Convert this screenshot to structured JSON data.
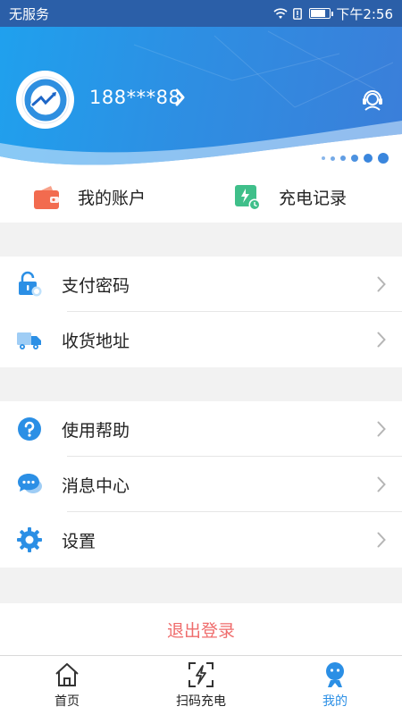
{
  "status_bar": {
    "carrier": "无服务",
    "time": "下午2:56",
    "battery_level": 0.8
  },
  "profile": {
    "phone": "188***88"
  },
  "quick_actions": [
    {
      "label": "我的账户",
      "icon": "wallet-icon",
      "color": "#f26b4f"
    },
    {
      "label": "充电记录",
      "icon": "charge-record-icon",
      "color": "#3fbf8a"
    }
  ],
  "menu_group_1": [
    {
      "label": "支付密码",
      "icon": "lock-icon"
    },
    {
      "label": "收货地址",
      "icon": "truck-icon"
    }
  ],
  "menu_group_2": [
    {
      "label": "使用帮助",
      "icon": "help-icon"
    },
    {
      "label": "消息中心",
      "icon": "message-icon"
    },
    {
      "label": "设置",
      "icon": "gear-icon"
    }
  ],
  "logout_label": "退出登录",
  "tabs": [
    {
      "label": "首页",
      "icon": "home-icon",
      "active": false
    },
    {
      "label": "扫码充电",
      "icon": "scan-charge-icon",
      "active": false
    },
    {
      "label": "我的",
      "icon": "profile-icon",
      "active": true
    }
  ],
  "colors": {
    "accent": "#2b8fe5",
    "logout": "#ef6c6c",
    "status_bar": "#2b5fa8"
  }
}
